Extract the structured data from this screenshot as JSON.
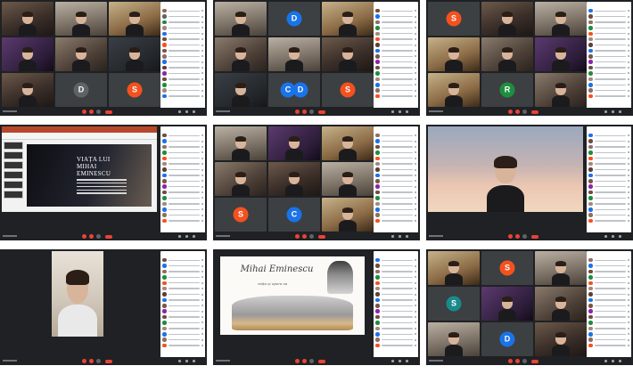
{
  "grid": {
    "columns": 3,
    "rows": 3
  },
  "shots": [
    {
      "id": "s1",
      "title": "Meet grid view with participant list",
      "avatars": [
        {
          "letter": "D",
          "color": "#3c4043"
        },
        {
          "letter": "S",
          "color": "#f4511e"
        }
      ]
    },
    {
      "id": "s2",
      "title": "Meet grid view with participant list",
      "avatars": [
        {
          "letter": "D",
          "color": "#1a73e8"
        },
        {
          "letter": "C",
          "color": "#1a73e8"
        },
        {
          "letter": "D",
          "color": "#1a73e8"
        },
        {
          "letter": "S",
          "color": "#f4511e"
        }
      ]
    },
    {
      "id": "s3",
      "title": "Meet grid view with participant list",
      "avatars": [
        {
          "letter": "S",
          "color": "#f4511e"
        },
        {
          "letter": "R",
          "color": "#1e8e3e"
        }
      ]
    },
    {
      "id": "s4",
      "title": "PowerPoint presentation shared",
      "slide_title": "VIAȚA LUI MIHAI EMINESCU"
    },
    {
      "id": "s5",
      "title": "Meet grid view with participant list",
      "avatars": [
        {
          "letter": "S",
          "color": "#f4511e"
        },
        {
          "letter": "C",
          "color": "#1a73e8"
        }
      ]
    },
    {
      "id": "s6",
      "title": "Single speaker view"
    },
    {
      "id": "s7",
      "title": "Single speaker view"
    },
    {
      "id": "s8",
      "title": "Mihai Eminescu slide shared",
      "slide_title": "Mihai Eminescu",
      "slide_sub": "viața și opera sa"
    },
    {
      "id": "s9",
      "title": "Meet grid view with participant list",
      "avatars": [
        {
          "letter": "S",
          "color": "#f4511e"
        },
        {
          "letter": "S",
          "color": "#1a8a8a"
        },
        {
          "letter": "D",
          "color": "#1a73e8"
        }
      ]
    }
  ],
  "colors": {
    "meet_bg": "#202124",
    "end_call": "#ea4335",
    "panel_bg": "#ffffff"
  }
}
